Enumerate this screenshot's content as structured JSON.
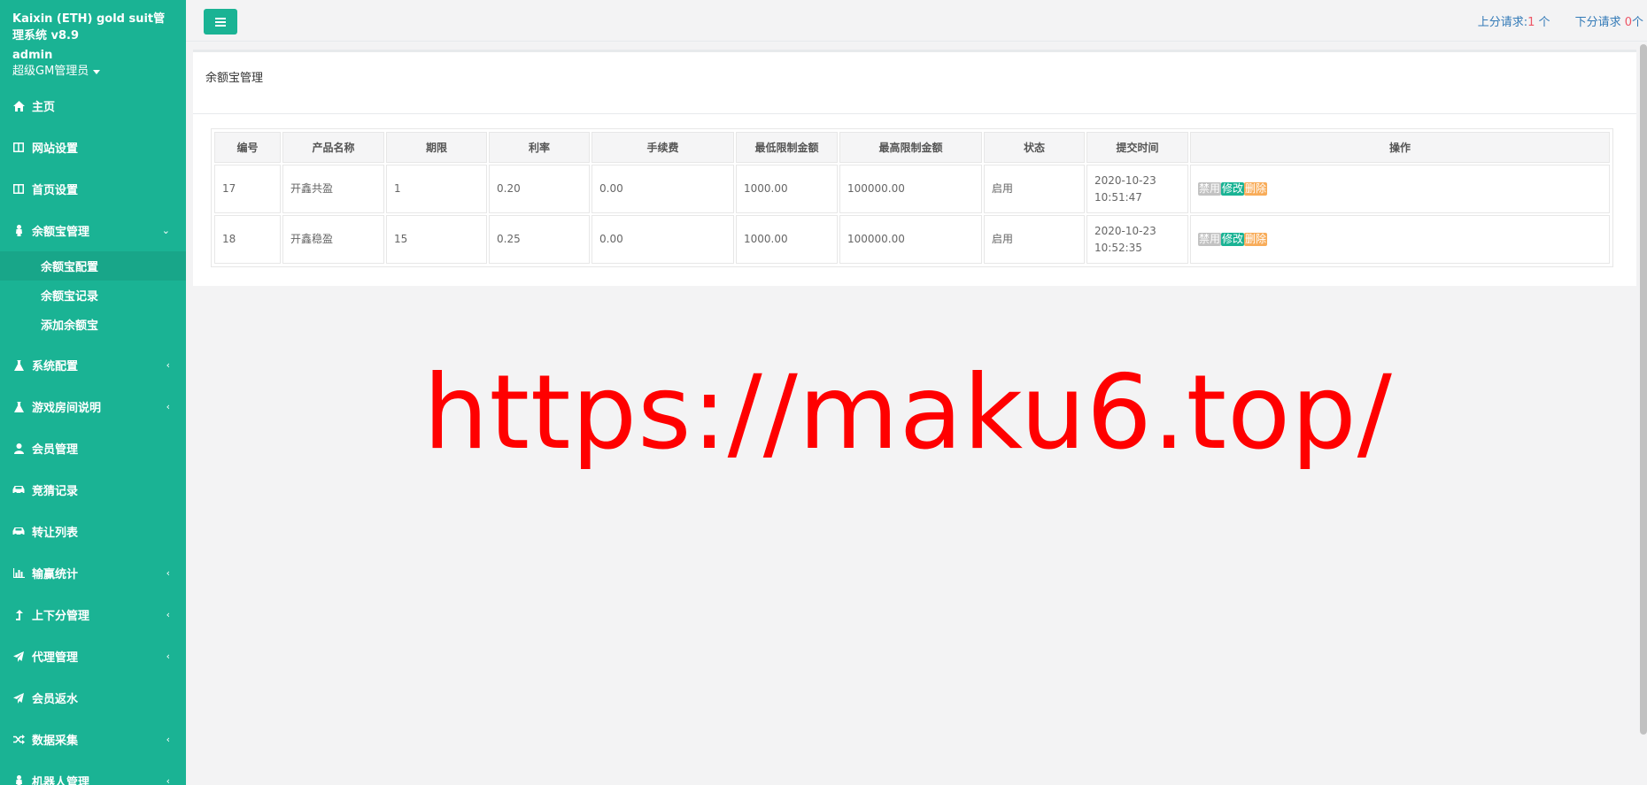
{
  "sidebar": {
    "app_title": "Kaixin (ETH) gold suit管理系统 v8.9",
    "user": "admin",
    "role": "超级GM管理员",
    "items": [
      {
        "label": "主页",
        "icon": "home-icon",
        "arrow": ""
      },
      {
        "label": "网站设置",
        "icon": "columns-icon",
        "arrow": ""
      },
      {
        "label": "首页设置",
        "icon": "columns-icon",
        "arrow": ""
      },
      {
        "label": "余额宝管理",
        "icon": "user-pawn-icon",
        "arrow": "⌄"
      },
      {
        "label": "系统配置",
        "icon": "flask-icon",
        "arrow": "‹"
      },
      {
        "label": "游戏房间说明",
        "icon": "flask-icon",
        "arrow": "‹"
      },
      {
        "label": "会员管理",
        "icon": "user-icon",
        "arrow": ""
      },
      {
        "label": "竞猜记录",
        "icon": "car-icon",
        "arrow": ""
      },
      {
        "label": "转让列表",
        "icon": "car-icon",
        "arrow": ""
      },
      {
        "label": "输赢统计",
        "icon": "bar-chart-icon",
        "arrow": "‹"
      },
      {
        "label": "上下分管理",
        "icon": "level-up-icon",
        "arrow": "‹"
      },
      {
        "label": "代理管理",
        "icon": "paper-plane-icon",
        "arrow": "‹"
      },
      {
        "label": "会员返水",
        "icon": "paper-plane-icon",
        "arrow": ""
      },
      {
        "label": "数据采集",
        "icon": "random-icon",
        "arrow": "‹"
      },
      {
        "label": "机器人管理",
        "icon": "user-pawn-icon",
        "arrow": "‹"
      }
    ],
    "subitems": [
      {
        "label": "余额宝配置",
        "active": true
      },
      {
        "label": "余额宝记录",
        "active": false
      },
      {
        "label": "添加余额宝",
        "active": false
      }
    ]
  },
  "topbar": {
    "up_label": "上分请求:",
    "up_count": "1",
    "up_unit": " 个",
    "down_label": "下分请求 ",
    "down_count": "0",
    "down_unit": "个"
  },
  "panel": {
    "title": "余额宝管理"
  },
  "table": {
    "headers": [
      "编号",
      "产品名称",
      "期限",
      "利率",
      "手续费",
      "最低限制金额",
      "最高限制金额",
      "状态",
      "提交时间",
      "操作"
    ],
    "rows": [
      {
        "id": "17",
        "name": "开鑫共盈",
        "term": "1",
        "rate": "0.20",
        "fee": "0.00",
        "min": "1000.00",
        "max": "100000.00",
        "status": "启用",
        "date": "2020-10-23",
        "time": "10:51:47"
      },
      {
        "id": "18",
        "name": "开鑫稳盈",
        "term": "15",
        "rate": "0.25",
        "fee": "0.00",
        "min": "1000.00",
        "max": "100000.00",
        "status": "启用",
        "date": "2020-10-23",
        "time": "10:52:35"
      }
    ],
    "actions": {
      "disable": "禁用",
      "edit": "修改",
      "delete": "删除"
    }
  },
  "watermark": "https://maku6.top/",
  "colors": {
    "sidebar": "#1ab394",
    "accent_red": "#ed5565",
    "link": "#337ab7",
    "watermark": "#ff0000"
  }
}
